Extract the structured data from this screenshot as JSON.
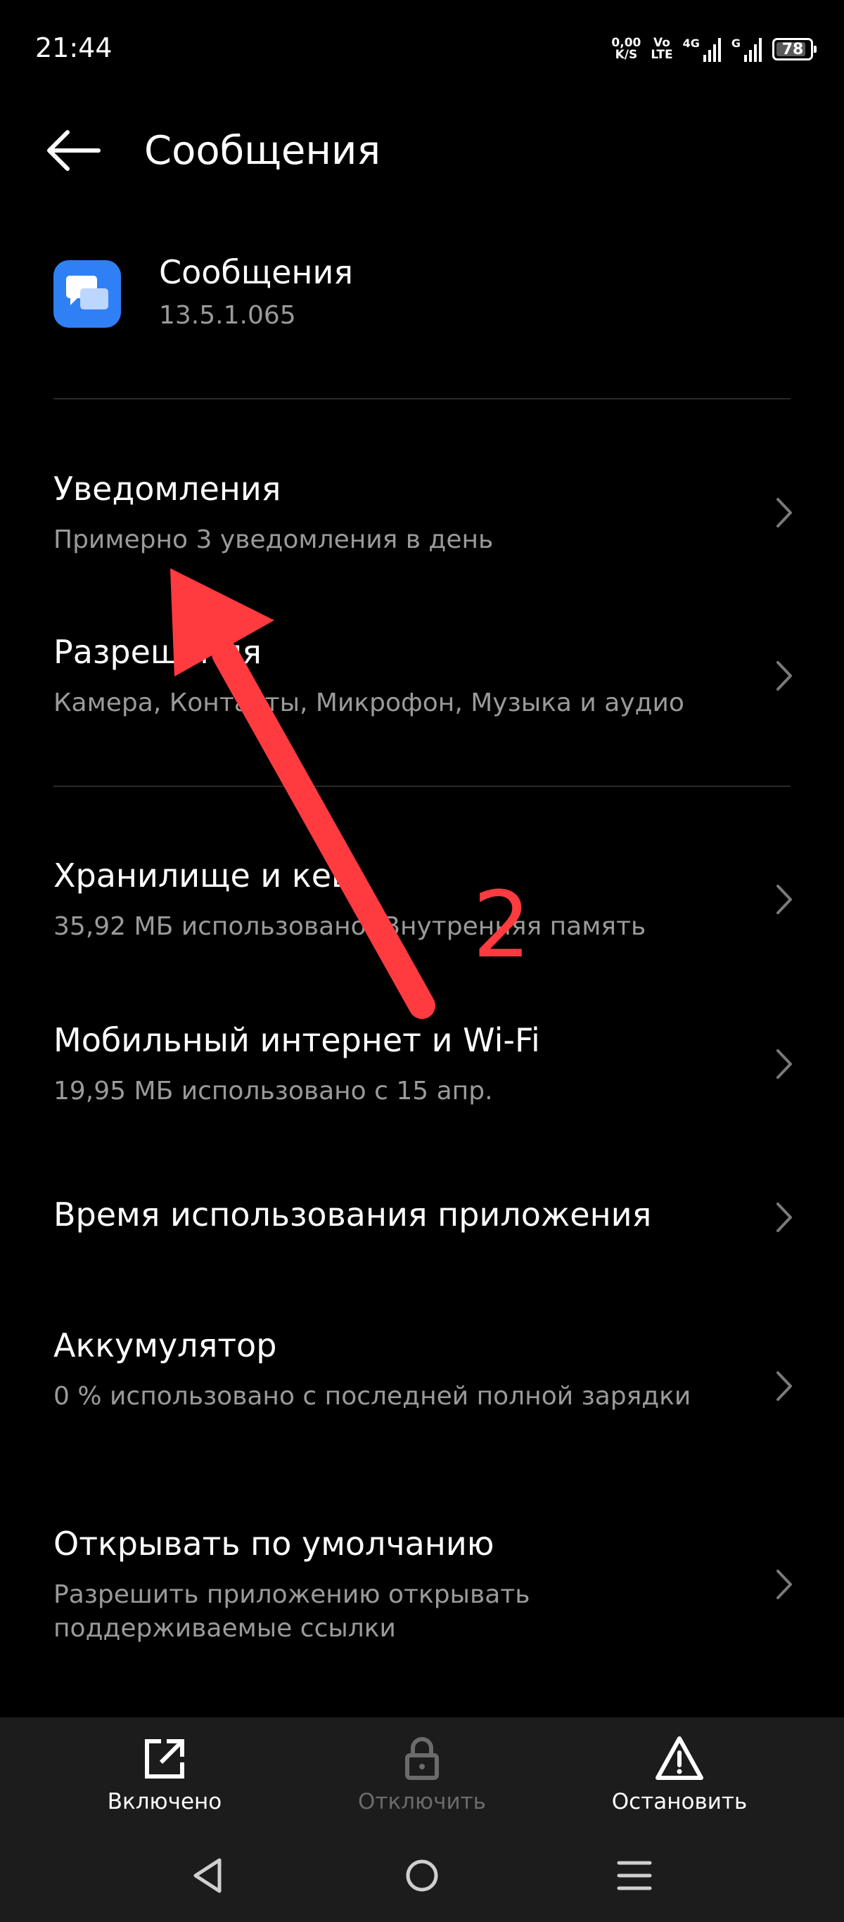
{
  "status_bar": {
    "time": "21:44",
    "net_speed_value": "0,00",
    "net_speed_unit": "K/S",
    "volte_top": "Vo",
    "volte_bottom": "LTE",
    "signal1_label": "4G",
    "signal2_label": "G",
    "battery": "78"
  },
  "header": {
    "title": "Сообщения",
    "back_icon": "arrow-left-icon"
  },
  "app": {
    "name": "Сообщения",
    "version": "13.5.1.065",
    "icon": "messages-icon",
    "icon_color": "#2f80f5"
  },
  "menu": {
    "notifications": {
      "title": "Уведомления",
      "subtitle": "Примерно 3 уведомления в день"
    },
    "permissions": {
      "title": "Разрешения",
      "subtitle": "Камера, Контакты, Микрофон, Музыка и аудио"
    },
    "storage": {
      "title": "Хранилище и кеш",
      "subtitle": "35,92 МБ использовано: Внутренняя память"
    },
    "mobile_data": {
      "title": "Мобильный интернет и Wi-Fi",
      "subtitle": "19,95 МБ использовано с 15 апр."
    },
    "usage_time": {
      "title": "Время использования приложения"
    },
    "battery": {
      "title": "Аккумулятор",
      "subtitle": "0 % использовано с последней полной зарядки"
    },
    "open_default": {
      "title": "Открывать по умолчанию",
      "subtitle": "Разрешить приложению открывать поддерживаемые ссылки"
    }
  },
  "annotation": {
    "number": "2",
    "color": "#ff3b3f"
  },
  "actions": {
    "enabled": "Включено",
    "disable": "Отключить",
    "stop": "Остановить"
  },
  "colors": {
    "background": "#000000",
    "bar_background": "#1c1c1c",
    "secondary_text": "#9a9a9a",
    "disabled_text": "#6b6b6b"
  }
}
